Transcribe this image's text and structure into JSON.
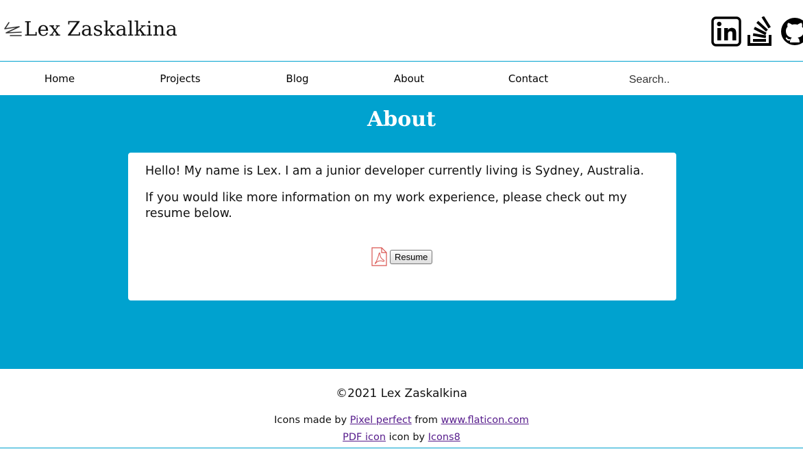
{
  "header": {
    "logo_text": "Lex Zaskalkina",
    "social_icons": [
      "linkedin-icon",
      "stackoverflow-icon",
      "github-icon"
    ]
  },
  "nav": {
    "items": [
      {
        "label": "Home"
      },
      {
        "label": "Projects"
      },
      {
        "label": "Blog"
      },
      {
        "label": "About"
      },
      {
        "label": "Contact"
      }
    ],
    "search_placeholder": "Search.."
  },
  "main": {
    "title": "About",
    "paragraphs": [
      "Hello! My name is Lex. I am a junior developer currently living is Sydney, Australia.",
      "If you would like more information on my work experience, please check out my resume below."
    ],
    "resume_button_label": "Resume",
    "pdf_icon": "pdf-icon"
  },
  "footer": {
    "copyright": "©2021 Lex Zaskalkina",
    "credits": {
      "line1_prefix": "Icons made by ",
      "line1_link1": "Pixel perfect",
      "line1_middle": " from ",
      "line1_link2": "www.flaticon.com",
      "line2_link1": "PDF icon",
      "line2_middle": " icon by ",
      "line2_link2": "Icons8"
    }
  },
  "colors": {
    "accent": "#00a2cf",
    "link": "#551a8b"
  }
}
